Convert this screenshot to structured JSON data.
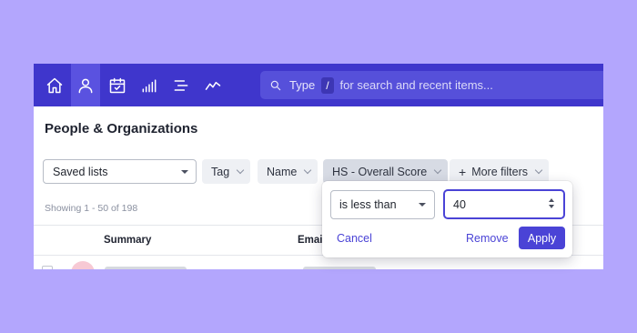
{
  "nav": {
    "icons": [
      "home-icon",
      "user-icon",
      "calendar-check-icon",
      "bar-signal-icon",
      "list-align-icon",
      "activity-line-icon"
    ],
    "active": "user-icon"
  },
  "search": {
    "type_label": "Type",
    "slash_key": "/",
    "hint": "for search and recent items..."
  },
  "page": {
    "title": "People & Organizations"
  },
  "filters": {
    "saved_lists": "Saved lists",
    "tag": "Tag",
    "name": "Name",
    "hs_score": "HS - Overall Score",
    "more": "More filters",
    "more_prefix": "+"
  },
  "results": {
    "showing": "Showing 1 - 50 of 198"
  },
  "table": {
    "headers": [
      "Summary",
      "Email"
    ]
  },
  "popover": {
    "operator": "is less than",
    "value": "40",
    "cancel": "Cancel",
    "remove": "Remove",
    "apply": "Apply"
  },
  "colors": {
    "topbar": "#3f36cc",
    "accent": "#4a43d6",
    "background": "#b3a6fd"
  }
}
